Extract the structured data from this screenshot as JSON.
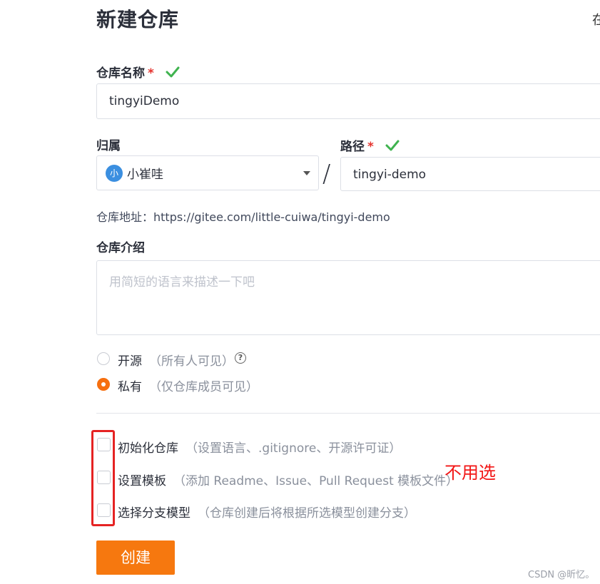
{
  "page": {
    "title": "新建仓库",
    "corner_char": "在"
  },
  "repo_name": {
    "label": "仓库名称",
    "required_mark": "*",
    "value": "tingyiDemo",
    "valid_icon": "check-icon"
  },
  "owner": {
    "label": "归属",
    "avatar_text": "小",
    "selected": "小崔哇"
  },
  "separator": "/",
  "path": {
    "label": "路径",
    "required_mark": "*",
    "value": "tingyi-demo",
    "valid_icon": "check-icon"
  },
  "repo_url": "仓库地址：https://gitee.com/little-cuiwa/tingyi-demo",
  "description": {
    "label": "仓库介绍",
    "placeholder": "用简短的语言来描述一下吧"
  },
  "visibility": {
    "options": [
      {
        "label": "开源",
        "hint": "（所有人可见）",
        "selected": false,
        "help": "?"
      },
      {
        "label": "私有",
        "hint": "（仅仓库成员可见）",
        "selected": true
      }
    ]
  },
  "extras": [
    {
      "label": "初始化仓库",
      "hint": "（设置语言、.gitignore、开源许可证）",
      "checked": false
    },
    {
      "label": "设置模板",
      "hint": "（添加 Readme、Issue、Pull Request 模板文件）",
      "checked": false
    },
    {
      "label": "选择分支模型",
      "hint": "（仓库创建后将根据所选模型创建分支）",
      "checked": false
    }
  ],
  "annotation": "不用选",
  "create_button": "创建",
  "watermark": "CSDN @昕忆。",
  "colors": {
    "accent": "#f6780f",
    "valid": "#3fb34f",
    "annotation": "#e52323"
  }
}
